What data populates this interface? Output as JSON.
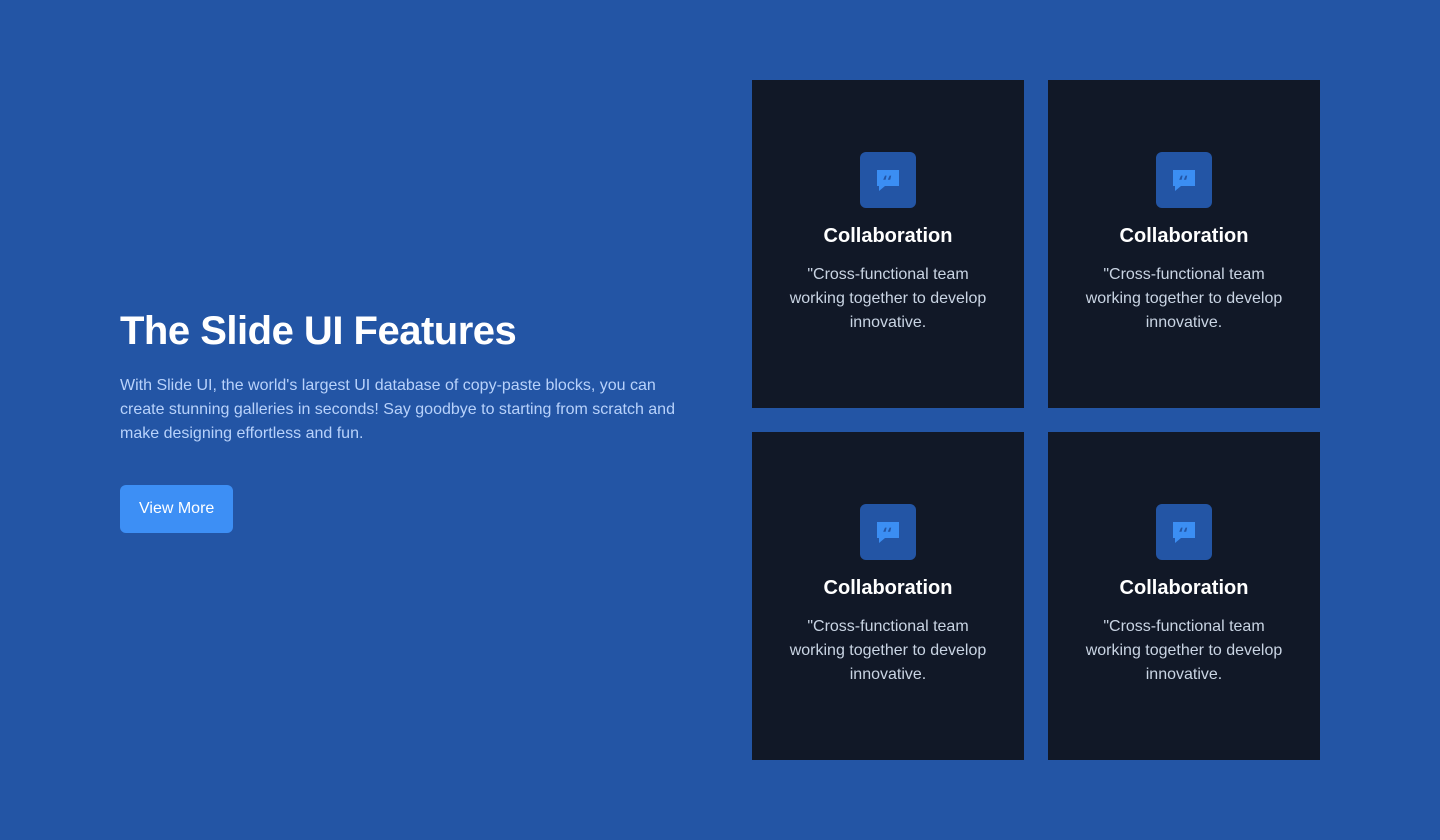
{
  "hero": {
    "title": "The Slide UI Features",
    "description": "With Slide UI, the world's largest UI database of copy-paste blocks, you can create stunning galleries in seconds! Say goodbye to starting from scratch and make designing effortless and fun.",
    "button_label": "View More"
  },
  "cards": [
    {
      "icon": "quote-bubble-icon",
      "title": "Collaboration",
      "description": "\"Cross-functional team working together to develop innovative."
    },
    {
      "icon": "quote-bubble-icon",
      "title": "Collaboration",
      "description": "\"Cross-functional team working together to develop innovative."
    },
    {
      "icon": "quote-bubble-icon",
      "title": "Collaboration",
      "description": "\"Cross-functional team working together to develop innovative."
    },
    {
      "icon": "quote-bubble-icon",
      "title": "Collaboration",
      "description": "\"Cross-functional team working together to develop innovative."
    }
  ],
  "colors": {
    "background": "#2355a5",
    "card_background": "#111827",
    "icon_box": "#2355a5",
    "icon_glyph": "#3b8ef3",
    "button": "#3d8ff5",
    "hero_description": "#b8d2fb",
    "card_description": "#c9d4e3"
  }
}
